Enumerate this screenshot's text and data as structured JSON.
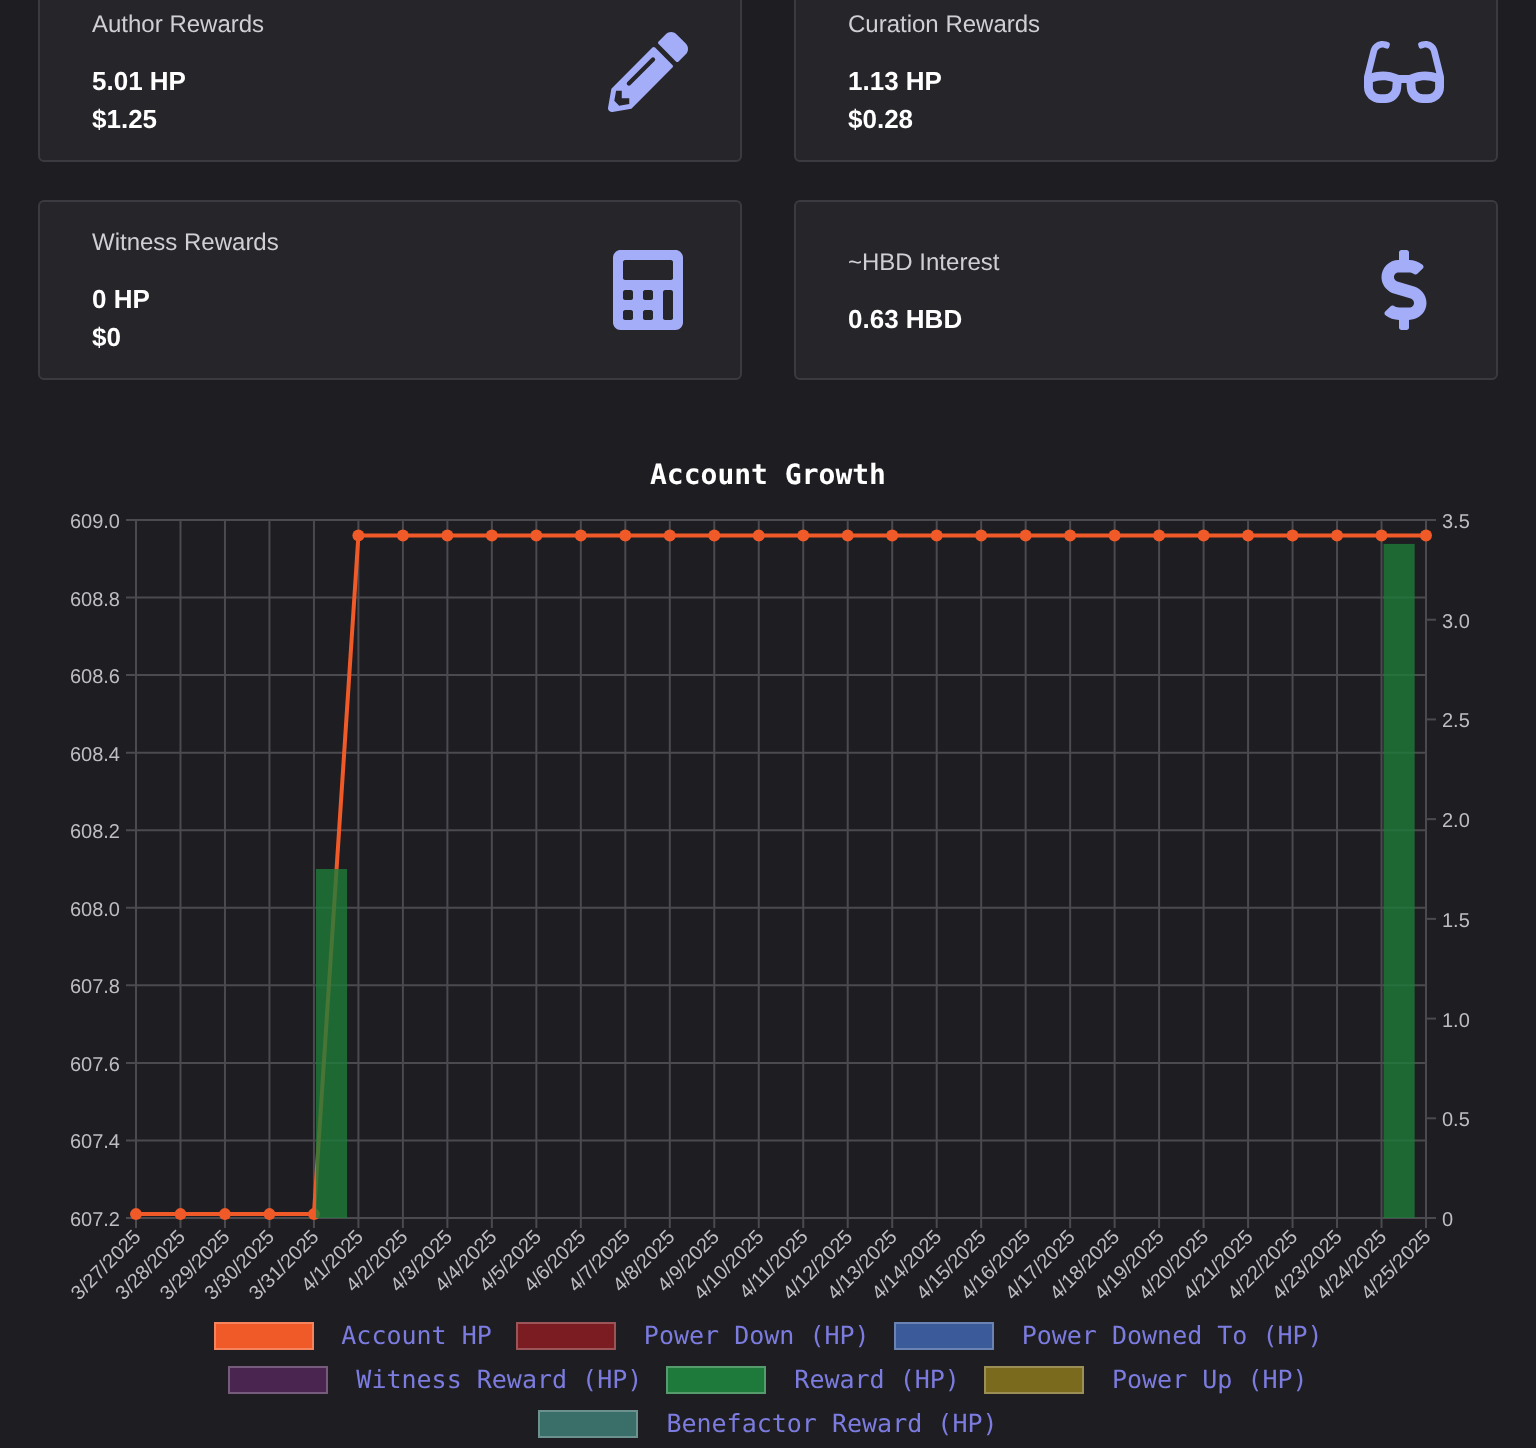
{
  "cards": [
    {
      "label": "Author Rewards",
      "lines": [
        "5.01 HP",
        "$1.25"
      ]
    },
    {
      "label": "Curation Rewards",
      "lines": [
        "1.13 HP",
        "$0.28"
      ]
    },
    {
      "label": "Witness Rewards",
      "lines": [
        "0 HP",
        "$0"
      ]
    },
    {
      "label": "~HBD Interest",
      "lines": [
        "0.63 HBD"
      ]
    }
  ],
  "chart": {
    "title": "Account Growth",
    "chart_data": {
      "type": "line",
      "categories": [
        "3/27/2025",
        "3/28/2025",
        "3/29/2025",
        "3/30/2025",
        "3/31/2025",
        "4/1/2025",
        "4/2/2025",
        "4/3/2025",
        "4/4/2025",
        "4/5/2025",
        "4/6/2025",
        "4/7/2025",
        "4/8/2025",
        "4/9/2025",
        "4/10/2025",
        "4/11/2025",
        "4/12/2025",
        "4/13/2025",
        "4/14/2025",
        "4/15/2025",
        "4/16/2025",
        "4/17/2025",
        "4/18/2025",
        "4/19/2025",
        "4/20/2025",
        "4/21/2025",
        "4/22/2025",
        "4/23/2025",
        "4/24/2025",
        "4/25/2025"
      ],
      "series": [
        {
          "name": "Account HP",
          "color": "#f05a28",
          "marker": true,
          "values": [
            607.21,
            607.21,
            607.21,
            607.21,
            607.21,
            608.96,
            608.96,
            608.96,
            608.96,
            608.96,
            608.96,
            608.96,
            608.96,
            608.96,
            608.96,
            608.96,
            608.96,
            608.96,
            608.96,
            608.96,
            608.96,
            608.96,
            608.96,
            608.96,
            608.96,
            608.96,
            608.96,
            608.96,
            608.96,
            608.96
          ]
        },
        {
          "name": "Power Down (HP)",
          "color": "#7a1c22",
          "axis": "y2",
          "type": "bar",
          "values": [
            null,
            null,
            null,
            null,
            null,
            null,
            null,
            null,
            null,
            null,
            null,
            null,
            null,
            null,
            null,
            null,
            null,
            null,
            null,
            null,
            null,
            null,
            null,
            null,
            null,
            null,
            null,
            null,
            null,
            null
          ]
        },
        {
          "name": "Power Downed To (HP)",
          "color": "#3a5a9a",
          "axis": "y2",
          "type": "bar",
          "values": [
            null,
            null,
            null,
            null,
            null,
            null,
            null,
            null,
            null,
            null,
            null,
            null,
            null,
            null,
            null,
            null,
            null,
            null,
            null,
            null,
            null,
            null,
            null,
            null,
            null,
            null,
            null,
            null,
            null,
            null
          ]
        },
        {
          "name": "Witness Reward (HP)",
          "color": "#4a2550",
          "axis": "y2",
          "type": "bar",
          "values": [
            null,
            null,
            null,
            null,
            null,
            null,
            null,
            null,
            null,
            null,
            null,
            null,
            null,
            null,
            null,
            null,
            null,
            null,
            null,
            null,
            null,
            null,
            null,
            null,
            null,
            null,
            null,
            null,
            null,
            null
          ]
        },
        {
          "name": "Reward (HP)",
          "color": "#1e7a3a",
          "axis": "y2",
          "type": "bar",
          "values": [
            null,
            null,
            null,
            null,
            1.75,
            null,
            null,
            null,
            null,
            null,
            null,
            null,
            null,
            null,
            null,
            null,
            null,
            null,
            null,
            null,
            null,
            null,
            null,
            null,
            null,
            null,
            null,
            null,
            3.38,
            null
          ]
        },
        {
          "name": "Power Up (HP)",
          "color": "#7a6a1e",
          "axis": "y2",
          "type": "bar",
          "values": [
            null,
            null,
            null,
            null,
            null,
            null,
            null,
            null,
            null,
            null,
            null,
            null,
            null,
            null,
            null,
            null,
            null,
            null,
            null,
            null,
            null,
            null,
            null,
            null,
            null,
            null,
            null,
            null,
            null,
            null
          ]
        },
        {
          "name": "Benefactor Reward (HP)",
          "color": "#3a6e68",
          "axis": "y2",
          "type": "bar",
          "values": [
            null,
            null,
            null,
            null,
            null,
            null,
            null,
            null,
            null,
            null,
            null,
            null,
            null,
            null,
            null,
            null,
            null,
            null,
            null,
            null,
            null,
            null,
            null,
            null,
            null,
            null,
            null,
            null,
            null,
            null
          ]
        }
      ],
      "grid": true,
      "ylim": [
        607.2,
        609.0
      ],
      "yticks": [
        {
          "value": 607.2,
          "label": "607.2"
        },
        {
          "value": 607.4,
          "label": "607.4"
        },
        {
          "value": 607.6,
          "label": "607.6"
        },
        {
          "value": 607.8,
          "label": "607.8"
        },
        {
          "value": 608.0,
          "label": "608.0"
        },
        {
          "value": 608.2,
          "label": "608.2"
        },
        {
          "value": 608.4,
          "label": "608.4"
        },
        {
          "value": 608.6,
          "label": "608.6"
        },
        {
          "value": 608.8,
          "label": "608.8"
        },
        {
          "value": 609.0,
          "label": "609.0"
        }
      ],
      "y2lim": [
        0,
        3.5
      ],
      "y2ticks": [
        {
          "value": 0,
          "label": "0"
        },
        {
          "value": 0.5,
          "label": "0.5"
        },
        {
          "value": 1.0,
          "label": "1.0"
        },
        {
          "value": 1.5,
          "label": "1.5"
        },
        {
          "value": 2.0,
          "label": "2.0"
        },
        {
          "value": 2.5,
          "label": "2.5"
        },
        {
          "value": 3.0,
          "label": "3.0"
        },
        {
          "value": 3.5,
          "label": "3.5"
        }
      ]
    }
  }
}
